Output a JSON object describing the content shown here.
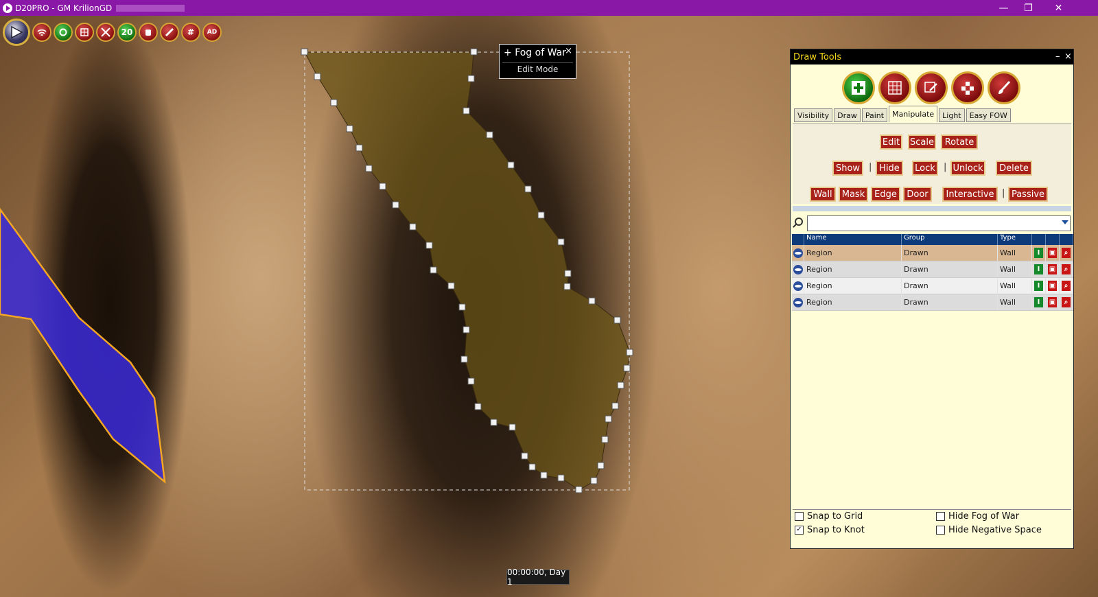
{
  "window": {
    "title": "D20PRO - GM KrilionGD",
    "min": "—",
    "max": "❐",
    "close": "✕"
  },
  "toolbar": {
    "dice_label": "20",
    "grid_label": "#",
    "ad_label": "AD"
  },
  "fog_popup": {
    "title": "Fog of War",
    "plus": "+",
    "close": "×",
    "mode": "Edit Mode"
  },
  "timer": "00:00:00, Day 1",
  "draw_tools": {
    "title": "Draw Tools",
    "minimize": "–",
    "close": "×",
    "tabs": [
      "Visibility",
      "Draw",
      "Paint",
      "Manipulate",
      "Light",
      "Easy FOW"
    ],
    "active_tab": "Manipulate",
    "buttons": {
      "edit": "Edit",
      "scale": "Scale",
      "rotate": "Rotate",
      "show": "Show",
      "hide": "Hide",
      "lock": "Lock",
      "unlock": "Unlock",
      "delete": "Delete",
      "wall": "Wall",
      "mask": "Mask",
      "edge": "Edge",
      "door": "Door",
      "interactive": "Interactive",
      "passive": "Passive"
    },
    "separator": "|",
    "search_value": "",
    "columns": [
      "Name",
      "Group",
      "Type"
    ],
    "rows": [
      {
        "name": "Region",
        "group": "Drawn",
        "type": "Wall"
      },
      {
        "name": "Region",
        "group": "Drawn",
        "type": "Wall"
      },
      {
        "name": "Region",
        "group": "Drawn",
        "type": "Wall"
      },
      {
        "name": "Region",
        "group": "Drawn",
        "type": "Wall"
      }
    ],
    "options": {
      "snap_grid": {
        "label": "Snap to Grid",
        "checked": false
      },
      "snap_knot": {
        "label": "Snap to Knot",
        "checked": true
      },
      "hide_fow": {
        "label": "Hide Fog of War",
        "checked": false
      },
      "hide_negative": {
        "label": "Hide Negative Space",
        "checked": false
      }
    }
  }
}
